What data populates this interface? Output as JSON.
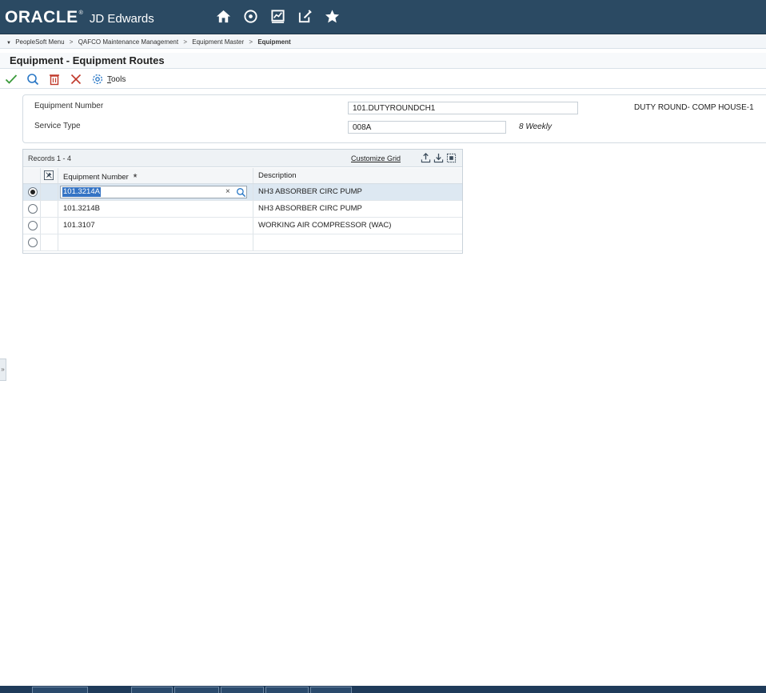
{
  "banner": {
    "brand_oracle": "ORACLE",
    "brand_reg": "®",
    "brand_product": "JD Edwards",
    "icons": [
      "home-icon",
      "recent-icon",
      "watchlist-icon",
      "open-app-icon",
      "favorites-icon"
    ]
  },
  "breadcrumb": {
    "items": [
      "PeopleSoft Menu",
      "QAFCO Maintenance Management",
      "Equipment Master",
      "Equipment"
    ],
    "separator": ">"
  },
  "form": {
    "title": "Equipment - Equipment Routes"
  },
  "toolbar": {
    "icons": [
      "ok-icon",
      "find-icon",
      "delete-icon",
      "cancel-icon",
      "tools-icon"
    ],
    "tools_label_accel": "T",
    "tools_label_rest": "ools"
  },
  "header": {
    "equipment_number_label": "Equipment Number",
    "equipment_number_value": "101.DUTYROUNDCH1",
    "equipment_description": "DUTY ROUND- COMP HOUSE-1",
    "service_type_label": "Service Type",
    "service_type_value": "008A",
    "service_type_description": "8 Weekly"
  },
  "grid": {
    "records_label": "Records 1 - 4",
    "customize_label": "Customize Grid",
    "columns": {
      "equipment_number": "Equipment Number",
      "required_marker": "*",
      "description": "Description"
    },
    "rows": [
      {
        "equipment_number": "101.3214A",
        "description": "NH3 ABSORBER CIRC PUMP",
        "selected": true
      },
      {
        "equipment_number": "101.3214B",
        "description": "NH3 ABSORBER CIRC PUMP",
        "selected": false
      },
      {
        "equipment_number": "101.3107",
        "description": "WORKING AIR COMPRESSOR (WAC)",
        "selected": false
      },
      {
        "equipment_number": "",
        "description": "",
        "selected": false
      }
    ],
    "clear_glyph": "×"
  },
  "side_handle": "»",
  "colors": {
    "banner": "#2b4a63",
    "selected_row": "#dde8f2",
    "selection_highlight": "#3574c4",
    "ok_green": "#3a9a3a",
    "action_blue": "#2a78c6",
    "cancel_red": "#c0392b"
  }
}
